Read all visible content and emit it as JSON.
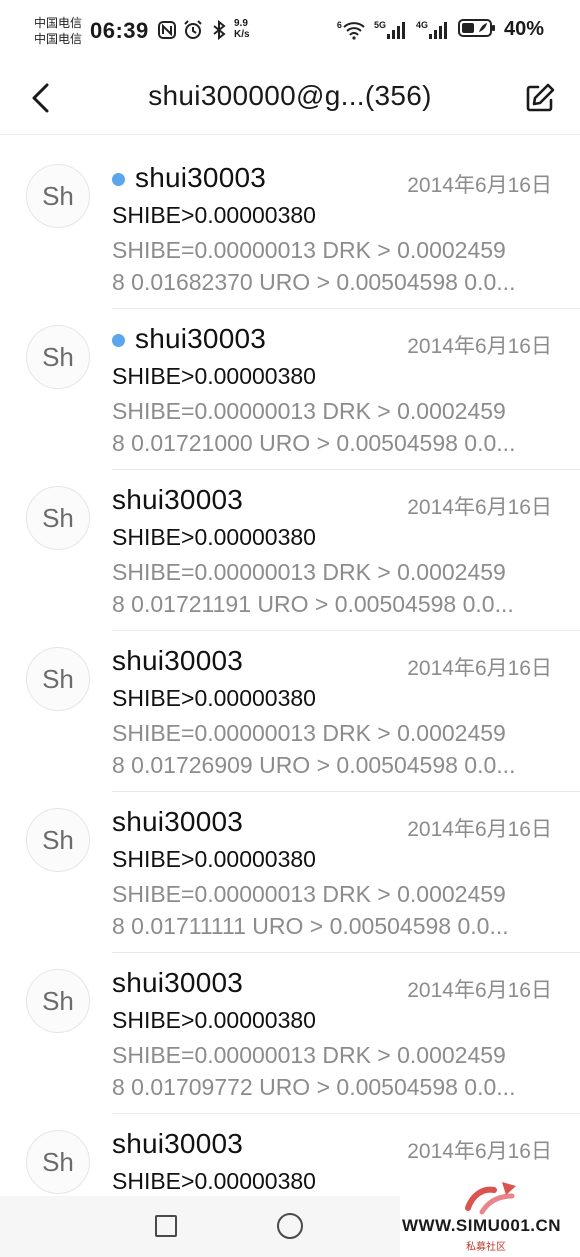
{
  "status_bar": {
    "carrier_1": "中国电信",
    "carrier_2": "中国电信",
    "time": "06:39",
    "net_speed_value": "9.9",
    "net_speed_unit": "K/s",
    "signal_1_label": "5G",
    "signal_2_label": "4G",
    "wifi_label": "6",
    "battery": "40%"
  },
  "header": {
    "title": "shui300000@g...(356)",
    "back_icon": "chevron-left-icon",
    "compose_icon": "compose-icon"
  },
  "messages": [
    {
      "avatar": "Sh",
      "sender": "shui30003",
      "unread": true,
      "date": "2014年6月16日",
      "subject": "SHIBE>0.00000380",
      "preview_line1": "SHIBE=0.00000013 DRK > 0.0002459",
      "preview_line2": "8 0.01682370 URO > 0.00504598 0.0..."
    },
    {
      "avatar": "Sh",
      "sender": "shui30003",
      "unread": true,
      "date": "2014年6月16日",
      "subject": "SHIBE>0.00000380",
      "preview_line1": "SHIBE=0.00000013 DRK > 0.0002459",
      "preview_line2": "8 0.01721000 URO > 0.00504598 0.0..."
    },
    {
      "avatar": "Sh",
      "sender": "shui30003",
      "unread": false,
      "date": "2014年6月16日",
      "subject": "SHIBE>0.00000380",
      "preview_line1": "SHIBE=0.00000013 DRK > 0.0002459",
      "preview_line2": "8 0.01721191 URO > 0.00504598 0.0..."
    },
    {
      "avatar": "Sh",
      "sender": "shui30003",
      "unread": false,
      "date": "2014年6月16日",
      "subject": "SHIBE>0.00000380",
      "preview_line1": "SHIBE=0.00000013 DRK > 0.0002459",
      "preview_line2": "8 0.01726909 URO > 0.00504598 0.0..."
    },
    {
      "avatar": "Sh",
      "sender": "shui30003",
      "unread": false,
      "date": "2014年6月16日",
      "subject": "SHIBE>0.00000380",
      "preview_line1": "SHIBE=0.00000013 DRK > 0.0002459",
      "preview_line2": "8 0.01711111 URO > 0.00504598 0.0..."
    },
    {
      "avatar": "Sh",
      "sender": "shui30003",
      "unread": false,
      "date": "2014年6月16日",
      "subject": "SHIBE>0.00000380",
      "preview_line1": "SHIBE=0.00000013 DRK > 0.0002459",
      "preview_line2": "8 0.01709772 URO > 0.00504598 0.0..."
    },
    {
      "avatar": "Sh",
      "sender": "shui30003",
      "unread": false,
      "date": "2014年6月16日",
      "subject": "SHIBE>0.00000380",
      "preview_line1": "",
      "preview_line2": ""
    }
  ],
  "nav_bar": {
    "recents_icon": "square-icon",
    "home_icon": "circle-icon"
  },
  "watermark": {
    "url": "WWW.SIMU001.CN",
    "subtitle": "私募社区"
  },
  "colors": {
    "unread_dot": "#5aa5ec",
    "secondary_text": "#8c8c8c",
    "primary_text": "#111111"
  }
}
